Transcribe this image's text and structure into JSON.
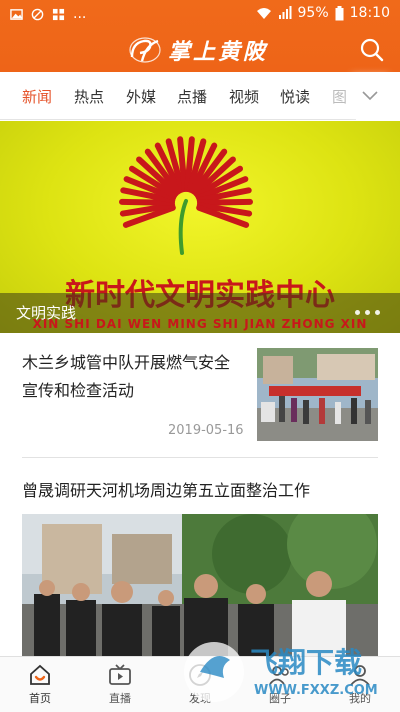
{
  "status_bar": {
    "battery": "95%",
    "time": "18:10",
    "overflow": "..."
  },
  "app": {
    "title": "掌上黄陂"
  },
  "tabs": [
    {
      "label": "新闻",
      "active": true
    },
    {
      "label": "热点",
      "active": false
    },
    {
      "label": "外媒",
      "active": false
    },
    {
      "label": "点播",
      "active": false
    },
    {
      "label": "视频",
      "active": false
    },
    {
      "label": "悦读",
      "active": false
    },
    {
      "label": "图",
      "active": false
    }
  ],
  "banner": {
    "headline": "新时代文明实践中心",
    "pinyin": "XIN SHI DAI WEN MING SHI JIAN ZHONG XIN",
    "caption": "文明实践",
    "indicator_count": 3
  },
  "articles": [
    {
      "title": "木兰乡城管中队开展燃气安全宣传和检查活动",
      "date": "2019-05-16"
    },
    {
      "title": "曾晟调研天河机场周边第五立面整治工作"
    }
  ],
  "bottom_nav": [
    {
      "label": "首页",
      "icon": "home-icon",
      "active": true
    },
    {
      "label": "直播",
      "icon": "tv-icon",
      "active": false
    },
    {
      "label": "发现",
      "icon": "compass-icon",
      "active": false
    },
    {
      "label": "圈子",
      "icon": "group-icon",
      "active": false
    },
    {
      "label": "我的",
      "icon": "user-icon",
      "active": false
    }
  ],
  "watermark": {
    "text": "飞翔下载",
    "url": "WWW.FXXZ.COM"
  },
  "colors": {
    "brand": "#ee6418",
    "active_tab": "#e5532a",
    "banner_red": "#c8171b"
  }
}
